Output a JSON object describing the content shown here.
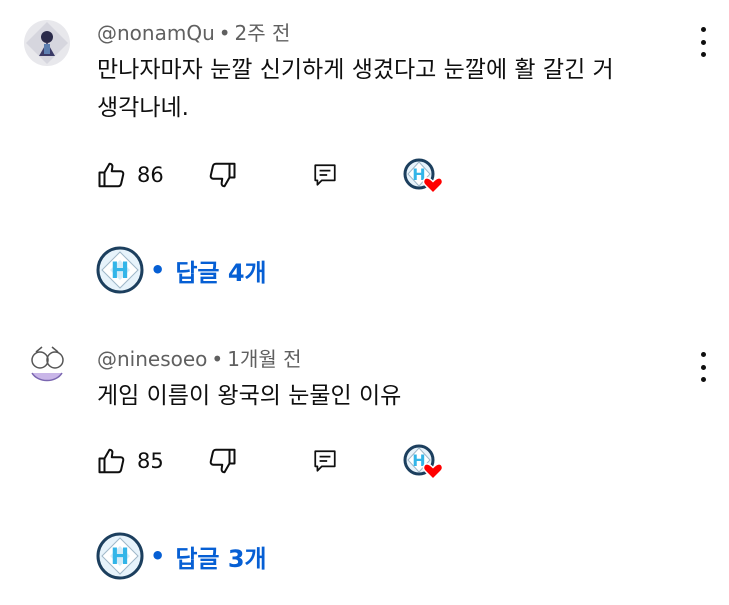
{
  "comments": [
    {
      "username": "@nonamQu",
      "separator": "•",
      "time": "2주 전",
      "text_lines": [
        "만나자마자 눈깔 신기하게 생겼다고 눈깔에 활 갈긴 거",
        "생각나네."
      ],
      "like_count": "86",
      "replies_label": "답글 4개",
      "avatar_icon": "anime-character-avatar-icon"
    },
    {
      "username": "@ninesoeo",
      "separator": "•",
      "time": "1개월 전",
      "text_lines": [
        "게임 이름이 왕국의 눈물인 이유"
      ],
      "like_count": "85",
      "replies_label": "답글 3개",
      "avatar_icon": "sketch-character-avatar-icon"
    }
  ],
  "colors": {
    "link_blue": "#065fd4",
    "meta_gray": "#606060",
    "heart_red": "#ff0000",
    "creator_ring": "#1c3f5e"
  }
}
